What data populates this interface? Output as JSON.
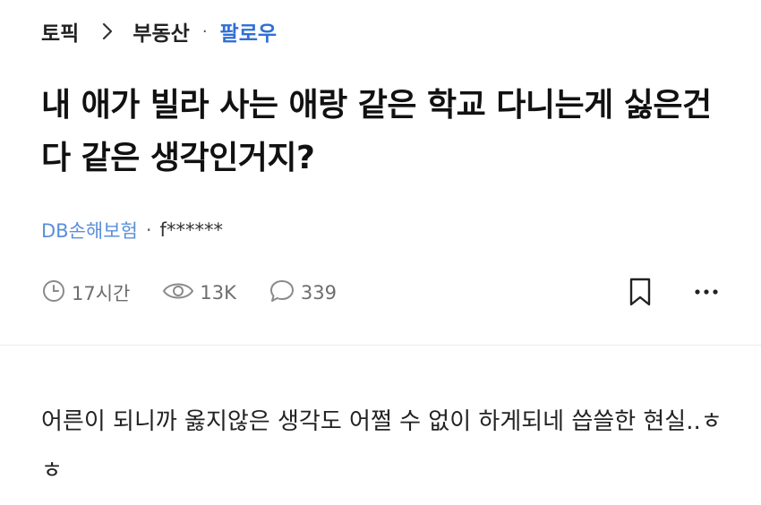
{
  "breadcrumb": {
    "topic": "토픽",
    "category": "부동산",
    "separator_dot": "·",
    "follow": "팔로우"
  },
  "post": {
    "title": "내 애가 빌라 사는 애랑 같은 학교 다니는게 싫은건 다 같은 생각인거지?",
    "company": "DB손해보험",
    "meta_dot": "·",
    "author": "f******",
    "time": "17시간",
    "views": "13K",
    "comments": "339",
    "body": "어른이 되니까 옳지않은 생각도 어쩔 수 없이 하게되네 씁쓸한 현실..ㅎㅎ"
  },
  "colors": {
    "accent": "#2f6fd6",
    "company": "#5b8fd9",
    "muted": "#6e6e6e"
  },
  "icons": {
    "breadcrumb_chevron": "chevron-right-icon",
    "time": "clock-icon",
    "views": "eye-icon",
    "comments": "comment-icon",
    "bookmark": "bookmark-icon",
    "more": "more-horizontal-icon"
  }
}
